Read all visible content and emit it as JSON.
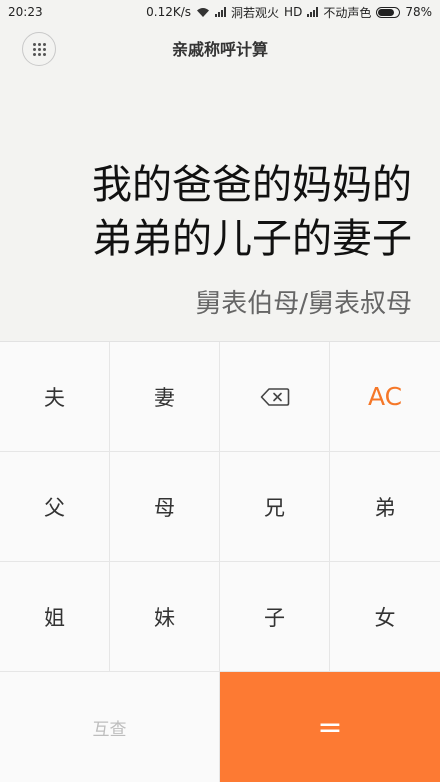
{
  "status": {
    "time": "20:23",
    "speed": "0.12K/s",
    "carrier1": "洞若观火",
    "hd": "HD",
    "carrier2": "不动声色",
    "battery": "78%",
    "battery_level": 0.78
  },
  "header": {
    "title": "亲戚称呼计算"
  },
  "display": {
    "expression_line1": "我的爸爸的妈妈的",
    "expression_line2": "弟弟的儿子的妻子",
    "result": "舅表伯母/舅表叔母"
  },
  "keys": {
    "husband": "夫",
    "wife": "妻",
    "clear": "AC",
    "father": "父",
    "mother": "母",
    "elder_brother": "兄",
    "younger_brother": "弟",
    "elder_sister": "姐",
    "younger_sister": "妹",
    "son": "子",
    "daughter": "女",
    "mutual": "互查",
    "equals": "="
  },
  "colors": {
    "accent": "#fd7a33",
    "ac_text": "#f57728"
  }
}
